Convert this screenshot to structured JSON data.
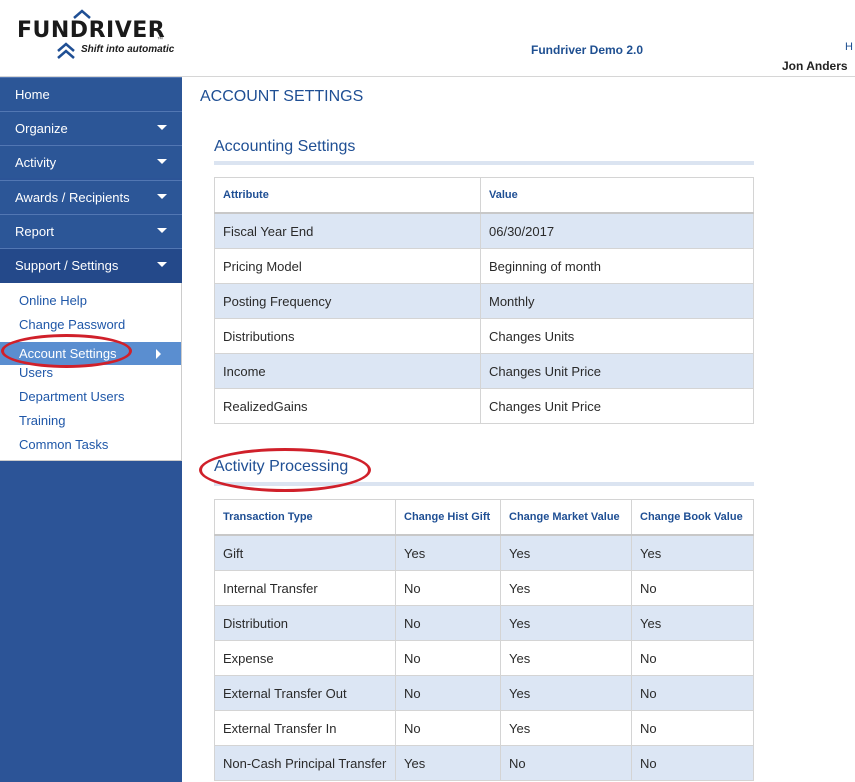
{
  "header": {
    "brand": "FUNDRIVER",
    "trademark": "™",
    "tagline": "Shift into automatic",
    "app_title": "Fundriver Demo 2.0",
    "help_link": "H",
    "user_name": "Jon Anders"
  },
  "sidebar": {
    "items": [
      {
        "label": "Home",
        "has_caret": false
      },
      {
        "label": "Organize",
        "has_caret": true
      },
      {
        "label": "Activity",
        "has_caret": true
      },
      {
        "label": "Awards / Recipients",
        "has_caret": true
      },
      {
        "label": "Report",
        "has_caret": true
      },
      {
        "label": "Support / Settings",
        "has_caret": true
      }
    ],
    "subitems": [
      {
        "label": "Online Help"
      },
      {
        "label": "Change Password"
      },
      {
        "label": "Account Settings",
        "selected": true
      },
      {
        "label": "Users"
      },
      {
        "label": "Department Users"
      },
      {
        "label": "Training"
      },
      {
        "label": "Common Tasks"
      }
    ]
  },
  "main": {
    "page_title": "ACCOUNT SETTINGS",
    "accounting": {
      "title": "Accounting Settings",
      "headers": [
        "Attribute",
        "Value"
      ],
      "rows": [
        [
          "Fiscal Year End",
          "06/30/2017"
        ],
        [
          "Pricing Model",
          "Beginning of month"
        ],
        [
          "Posting Frequency",
          "Monthly"
        ],
        [
          "Distributions",
          "Changes Units"
        ],
        [
          "Income",
          "Changes Unit Price"
        ],
        [
          "RealizedGains",
          "Changes Unit Price"
        ]
      ]
    },
    "activity": {
      "title": "Activity Processing",
      "headers": [
        "Transaction Type",
        "Change Hist Gift",
        "Change Market Value",
        "Change Book Value"
      ],
      "rows": [
        [
          "Gift",
          "Yes",
          "Yes",
          "Yes"
        ],
        [
          "Internal Transfer",
          "No",
          "Yes",
          "No"
        ],
        [
          "Distribution",
          "No",
          "Yes",
          "Yes"
        ],
        [
          "Expense",
          "No",
          "Yes",
          "No"
        ],
        [
          "External Transfer Out",
          "No",
          "Yes",
          "No"
        ],
        [
          "External Transfer In",
          "No",
          "Yes",
          "No"
        ],
        [
          "Non-Cash Principal Transfer",
          "Yes",
          "No",
          "No"
        ]
      ]
    }
  },
  "colors": {
    "nav_bg": "#2c5697",
    "link": "#1f57a8",
    "title": "#1f4f94",
    "row_alt": "#dce6f4",
    "annotation": "#d0202a"
  }
}
